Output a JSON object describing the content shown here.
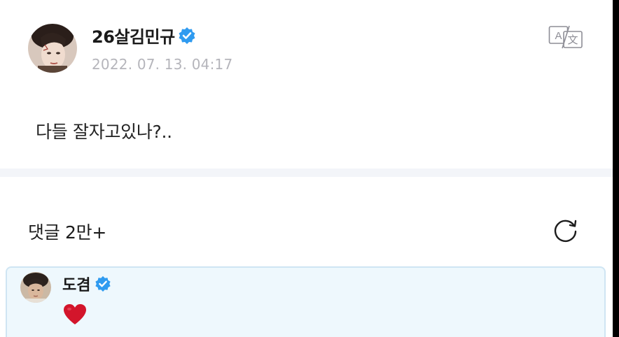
{
  "post": {
    "author": "26살김민규",
    "verified_icon": "verified-badge-icon",
    "timestamp": "2022. 07. 13. 04:17",
    "body": "다들 잘자고있나?..",
    "translate_icon": "translate-icon"
  },
  "comments": {
    "title": "댓글 2만+",
    "refresh_icon": "refresh-icon",
    "items": [
      {
        "author": "도겸",
        "verified_icon": "verified-badge-icon",
        "content_icon": "red-heart-icon"
      }
    ]
  },
  "colors": {
    "verified": "#2f9bf0",
    "timestamp": "#b5b5bb",
    "divider": "#f3f5f9",
    "comment_bg": "#eef8fd",
    "comment_border": "#cfe5f3",
    "heart": "#d3152b"
  }
}
